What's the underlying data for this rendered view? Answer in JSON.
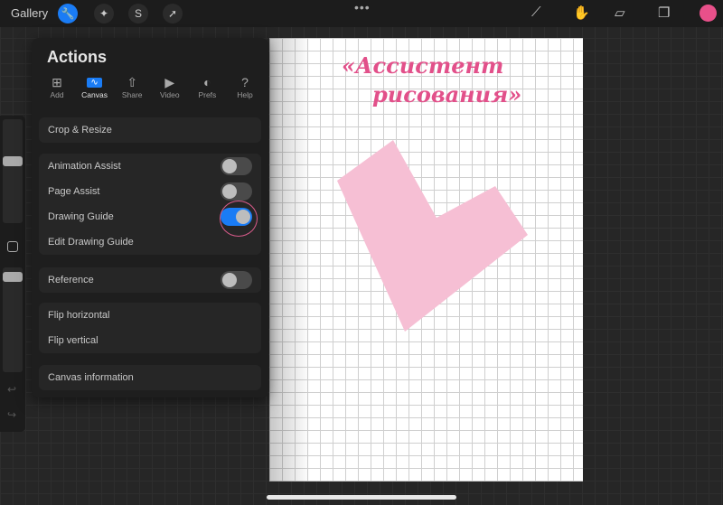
{
  "topbar": {
    "gallery": "Gallery",
    "tools": [
      "wrench-icon",
      "magic-wand-icon",
      "selection-icon",
      "transform-arrow-icon"
    ],
    "right_tools": [
      "brush-icon",
      "smudge-icon",
      "eraser-icon",
      "layers-icon"
    ],
    "color": "#e8508a"
  },
  "canvas": {
    "title_line1": "«Ассистент",
    "title_line2": "рисования»",
    "shape_color": "#f6bfd4"
  },
  "actions": {
    "title": "Actions",
    "tabs": [
      {
        "label": "Add",
        "icon": "add-layer-icon"
      },
      {
        "label": "Canvas",
        "icon": "canvas-icon",
        "active": true
      },
      {
        "label": "Share",
        "icon": "share-icon"
      },
      {
        "label": "Video",
        "icon": "play-icon"
      },
      {
        "label": "Prefs",
        "icon": "toggle-icon"
      },
      {
        "label": "Help",
        "icon": "help-icon"
      }
    ],
    "crop": "Crop & Resize",
    "animation_assist": "Animation Assist",
    "animation_assist_on": false,
    "page_assist": "Page Assist",
    "page_assist_on": false,
    "drawing_guide": "Drawing Guide",
    "drawing_guide_on": true,
    "edit_drawing_guide": "Edit Drawing Guide",
    "reference": "Reference",
    "reference_on": false,
    "flip_h": "Flip horizontal",
    "flip_v": "Flip vertical",
    "canvas_info": "Canvas information"
  }
}
